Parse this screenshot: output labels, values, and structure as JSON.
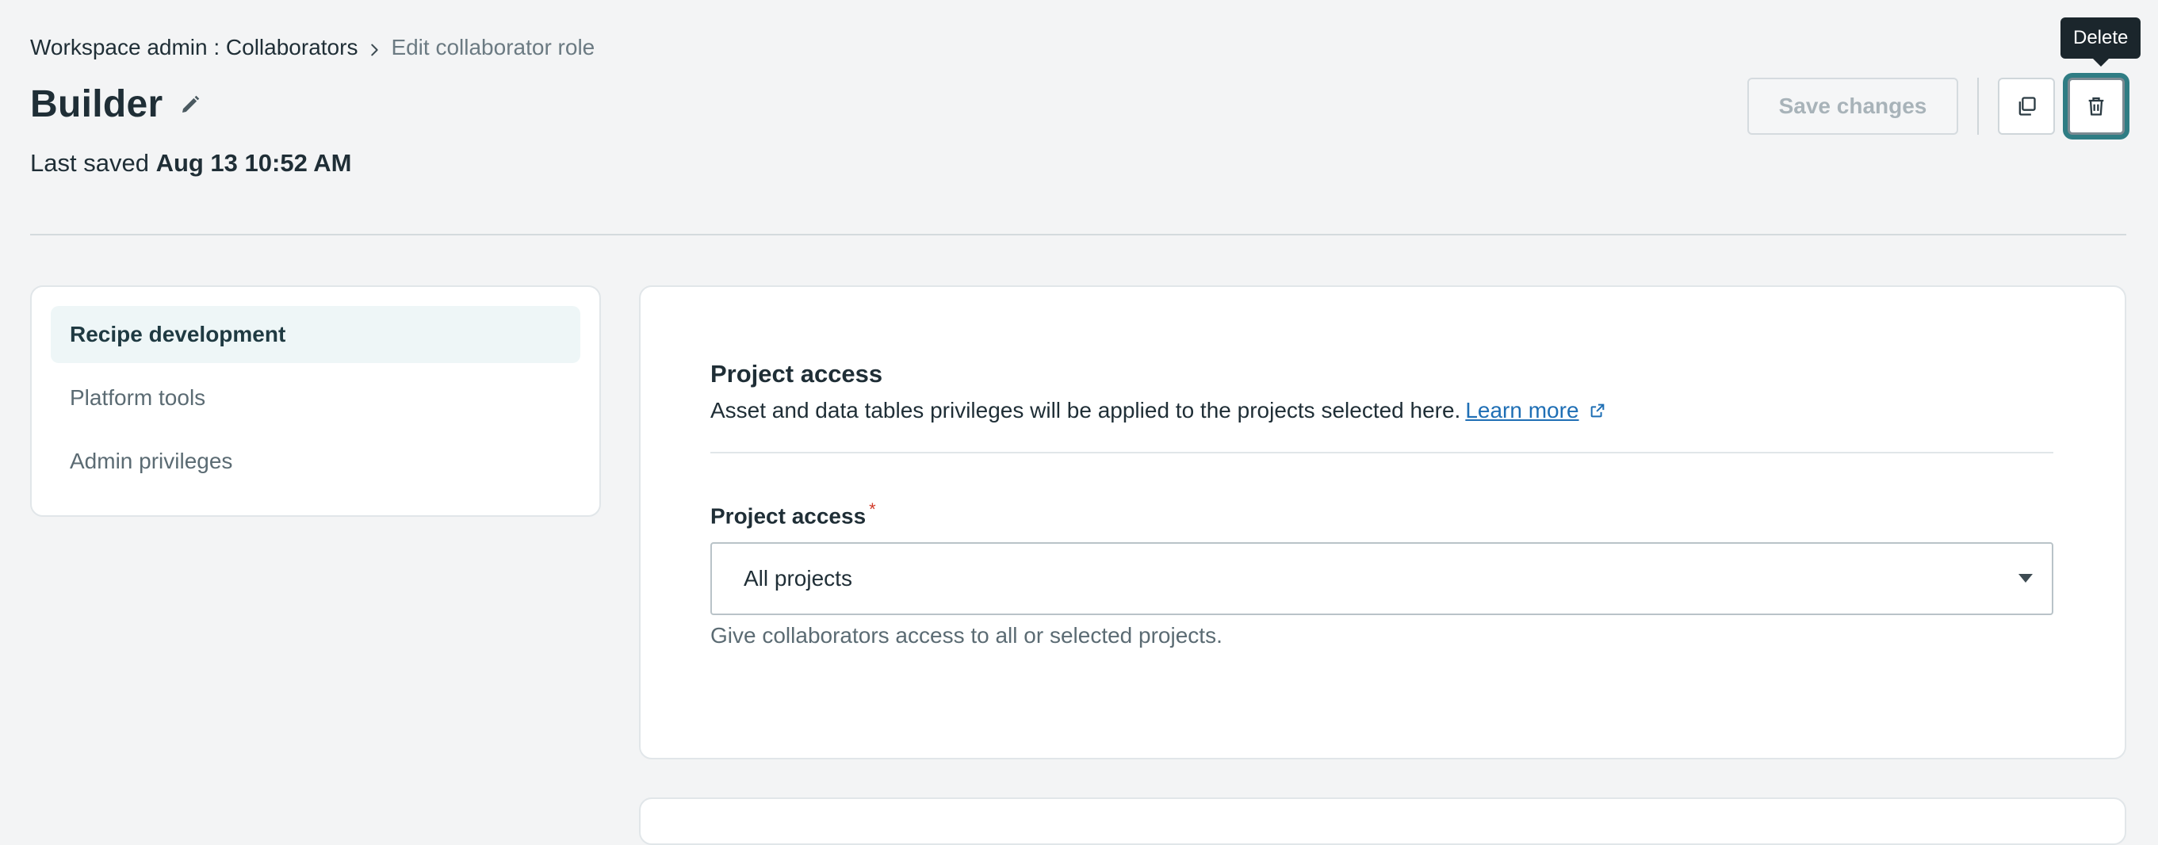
{
  "breadcrumb": {
    "parent": "Workspace admin : Collaborators",
    "current": "Edit collaborator role"
  },
  "page": {
    "title": "Builder",
    "last_saved_label": "Last saved",
    "last_saved_value": "Aug 13 10:52 AM"
  },
  "toolbar": {
    "save_label": "Save changes",
    "save_disabled": true,
    "delete_tooltip": "Delete"
  },
  "sidebar": {
    "items": [
      {
        "label": "Recipe development",
        "active": true
      },
      {
        "label": "Platform tools",
        "active": false
      },
      {
        "label": "Admin privileges",
        "active": false
      }
    ]
  },
  "project_access": {
    "section_title": "Project access",
    "description": "Asset and data tables privileges will be applied to the projects selected here.",
    "learn_more": "Learn more",
    "field_label": "Project access",
    "required_mark": "*",
    "selected_value": "All projects",
    "help_text": "Give collaborators access to all or selected projects."
  },
  "colors": {
    "background": "#f3f4f5",
    "primary_text": "#1f2e36",
    "link": "#1f6fb5",
    "focus_ring": "#2f7d84",
    "required": "#d13b2a"
  },
  "icons": {
    "edit": "pencil-icon",
    "copy": "copy-icon",
    "delete": "trash-icon",
    "external": "external-link-icon",
    "dropdown": "caret-down-icon",
    "breadcrumb_separator": "chevron-right-icon"
  }
}
